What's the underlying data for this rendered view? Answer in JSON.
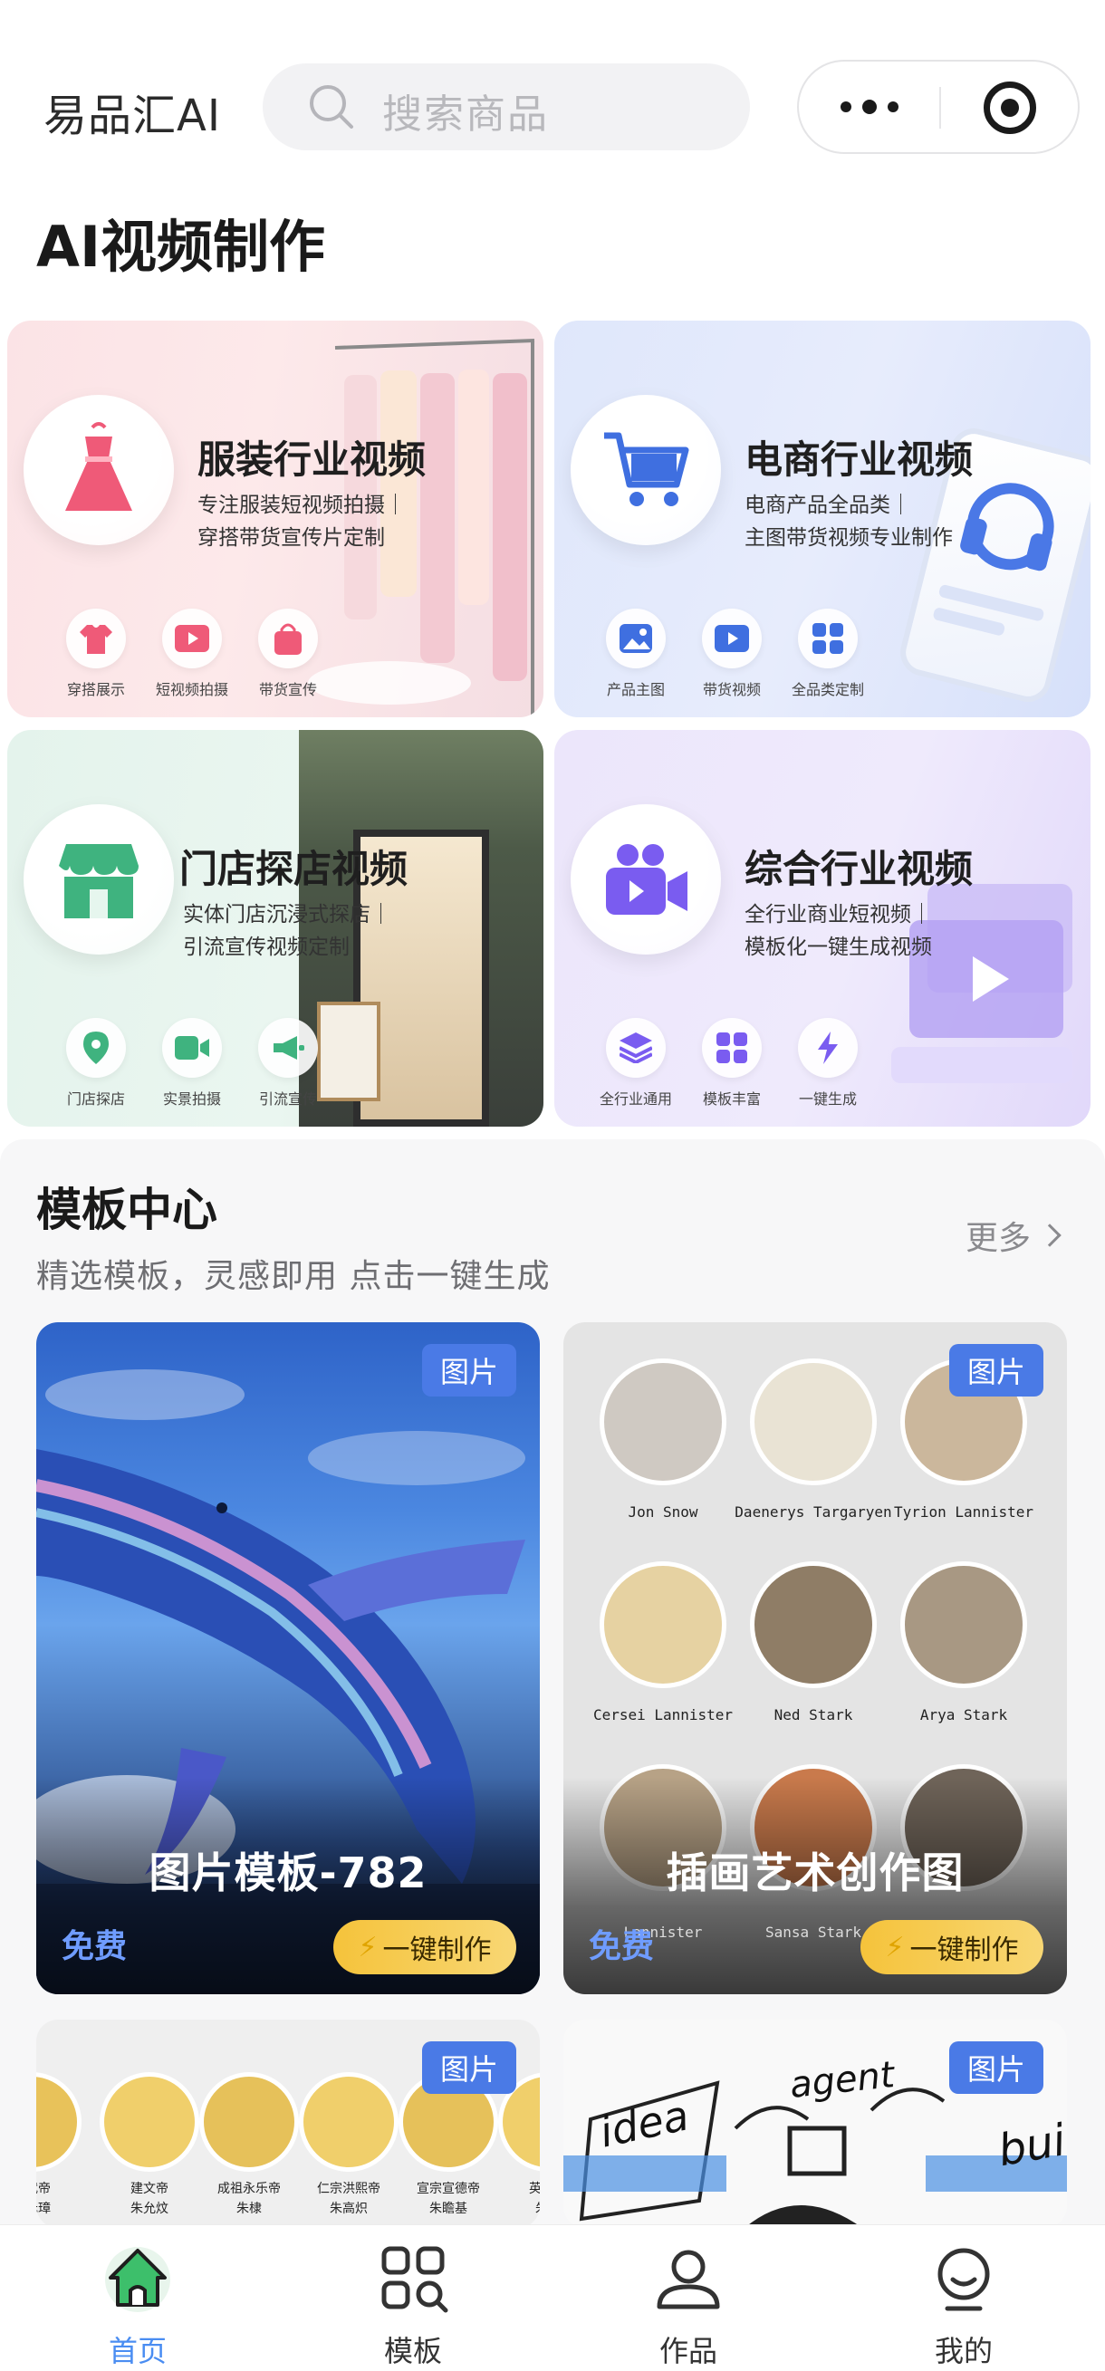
{
  "header": {
    "app_name": "易品汇AI",
    "search_placeholder": "搜索商品"
  },
  "section_title": "AI视频制作",
  "categories": [
    {
      "title": "服装行业视频",
      "desc_line1": "专注服装短视频拍摄｜",
      "desc_line2": "穿搭带货宣传片定制",
      "features": [
        "穿搭展示",
        "短视频拍摄",
        "带货宣传"
      ],
      "accent": "#ef5a78"
    },
    {
      "title": "电商行业视频",
      "desc_line1": "电商产品全品类｜",
      "desc_line2": "主图带货视频专业制作",
      "features": [
        "产品主图",
        "带货视频",
        "全品类定制"
      ],
      "accent": "#3f6fe0"
    },
    {
      "title": "门店探店视频",
      "desc_line1": "实体门店沉浸式探店｜",
      "desc_line2": "引流宣传视频定制",
      "features": [
        "门店探店",
        "实景拍摄",
        "引流宣传"
      ],
      "accent": "#3fb37f"
    },
    {
      "title": "综合行业视频",
      "desc_line1": "全行业商业短视频｜",
      "desc_line2": "模板化一键生成视频",
      "features": [
        "全行业通用",
        "模板丰富",
        "一键生成"
      ],
      "accent": "#7a5cf0"
    }
  ],
  "templates": {
    "title": "模板中心",
    "subtitle": "精选模板，灵感即用 点击一键生成",
    "more_label": "更多",
    "badge": "图片",
    "free_label": "免费",
    "make_label": "一键制作",
    "items": [
      {
        "name": "图片模板-782"
      },
      {
        "name": "插画艺术创作图",
        "portrait_labels": [
          "Jon Snow",
          "Daenerys Targaryen",
          "Tyrion Lannister",
          "Cersei Lannister",
          "Ned Stark",
          "Arya Stark",
          "Lannister",
          "Sansa Stark"
        ]
      },
      {
        "name": ""
      },
      {
        "name": ""
      }
    ],
    "partial_texts": {
      "card3_labels": [
        "洪武帝",
        "建文帝",
        "成祖永乐帝",
        "仁宗洪熙帝",
        "宣宗宣德帝",
        "英宗正"
      ],
      "card3_sublabels": [
        "朱元璋",
        "朱允炆",
        "朱棣",
        "朱高炽",
        "朱瞻基",
        "朱祁"
      ],
      "card4_words": [
        "idea",
        "agent",
        "buil"
      ]
    }
  },
  "tabbar": {
    "items": [
      {
        "label": "首页",
        "icon": "home-icon",
        "active": true
      },
      {
        "label": "模板",
        "icon": "template-grid-icon",
        "active": false
      },
      {
        "label": "作品",
        "icon": "works-user-icon",
        "active": false
      },
      {
        "label": "我的",
        "icon": "profile-icon",
        "active": false
      }
    ],
    "active_color": "#4a8df2"
  }
}
